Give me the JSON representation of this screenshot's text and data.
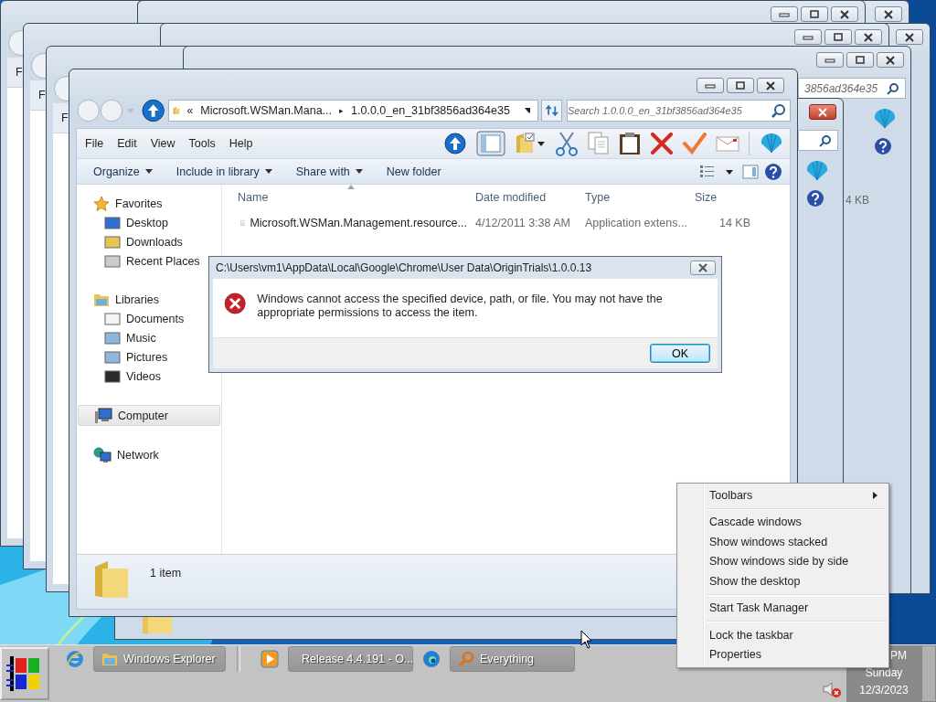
{
  "background_windows": [
    {
      "kind": "left",
      "menu_text": "F"
    },
    {
      "kind": "right",
      "close_hot": false
    },
    {
      "kind": "right",
      "close_hot": false
    },
    {
      "kind": "left",
      "menu_text": "F"
    },
    {
      "kind": "right",
      "close_hot": false
    },
    {
      "kind": "right",
      "close_hot": false
    },
    {
      "kind": "left",
      "menu_text": "F"
    },
    {
      "kind": "right",
      "close_hot": false,
      "search_text": "3856ad364e35",
      "toolbar_icons": true,
      "size_text": "4 KB"
    },
    {
      "kind": "right",
      "close_hot": true,
      "toolbar_icons": true,
      "status_icon": true
    }
  ],
  "explorer": {
    "address": {
      "overflow": "«",
      "parent": "Microsoft.WSMan.Mana...",
      "separator": "▸",
      "current": "1.0.0.0_en_31bf3856ad364e35"
    },
    "search": {
      "placeholder": "Search 1.0.0.0_en_31bf3856ad364e35"
    },
    "menu": [
      "File",
      "Edit",
      "View",
      "Tools",
      "Help"
    ],
    "commands": [
      {
        "label": "Organize",
        "dropdown": true
      },
      {
        "label": "Include in library",
        "dropdown": true
      },
      {
        "label": "Share with",
        "dropdown": true
      },
      {
        "label": "New folder",
        "dropdown": false
      }
    ],
    "columns": [
      "Name",
      "Date modified",
      "Type",
      "Size"
    ],
    "rows": [
      {
        "name": "Microsoft.WSMan.Management.resource...",
        "date": "4/12/2011 3:38 AM",
        "type": "Application extens...",
        "size": "14 KB"
      }
    ],
    "nav": [
      {
        "label": "Favorites",
        "selected": false,
        "children": [
          {
            "label": "Desktop",
            "selected": false
          },
          {
            "label": "Downloads",
            "selected": false
          },
          {
            "label": "Recent Places",
            "selected": false
          }
        ]
      },
      {
        "label": "Libraries",
        "selected": false,
        "children": [
          {
            "label": "Documents",
            "selected": false
          },
          {
            "label": "Music",
            "selected": false
          },
          {
            "label": "Pictures",
            "selected": false
          },
          {
            "label": "Videos",
            "selected": false
          }
        ]
      },
      {
        "label": "Computer",
        "selected": true
      },
      {
        "label": "Network",
        "selected": false
      }
    ],
    "status": "1 item"
  },
  "dialog": {
    "title": "C:\\Users\\vm1\\AppData\\Local\\Google\\Chrome\\User Data\\OriginTrials\\1.0.0.13",
    "message": "Windows cannot access the specified device, path, or file.  You may not have the appropriate permissions to access the item.",
    "button": "OK"
  },
  "context_menu": [
    {
      "kind": "item",
      "label": "Toolbars",
      "has_submenu": true
    },
    {
      "kind": "separator"
    },
    {
      "kind": "item",
      "label": "Cascade windows",
      "has_submenu": false
    },
    {
      "kind": "item",
      "label": "Show windows stacked",
      "has_submenu": false
    },
    {
      "kind": "item",
      "label": "Show windows side by side",
      "has_submenu": false
    },
    {
      "kind": "item",
      "label": "Show the desktop",
      "has_submenu": false
    },
    {
      "kind": "separator"
    },
    {
      "kind": "item",
      "label": "Start Task Manager",
      "has_submenu": false
    },
    {
      "kind": "separator"
    },
    {
      "kind": "item",
      "label": "Lock the taskbar",
      "has_submenu": false
    },
    {
      "kind": "item",
      "label": "Properties",
      "has_submenu": false
    }
  ],
  "taskbar": {
    "items": [
      {
        "kind": "pinned"
      },
      {
        "kind": "window",
        "label": "Windows Explorer"
      },
      {
        "kind": "pinned"
      },
      {
        "kind": "window",
        "label": "Release 4.4.191 - O..."
      },
      {
        "kind": "pinned"
      },
      {
        "kind": "window",
        "label": "Everything"
      }
    ],
    "clock": {
      "time": "PM",
      "day": "Sunday",
      "date": "12/3/2023"
    }
  }
}
